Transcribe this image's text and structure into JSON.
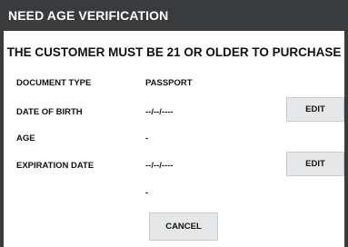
{
  "dialog": {
    "title": "NEED AGE VERIFICATION",
    "message": "THE CUSTOMER MUST BE 21 OR OLDER TO PURCHASE"
  },
  "fields": {
    "document_type": {
      "label": "DOCUMENT TYPE",
      "value": "PASSPORT"
    },
    "date_of_birth": {
      "label": "DATE OF BIRTH",
      "value": "--/--/----",
      "action": "EDIT"
    },
    "age": {
      "label": "AGE",
      "value": "-"
    },
    "expiration_date": {
      "label": "EXPIRATION DATE",
      "value": "--/--/----",
      "action": "EDIT"
    },
    "extra": {
      "value": "-"
    }
  },
  "actions": {
    "cancel": "CANCEL"
  },
  "colors": {
    "titlebar": "#3a3b3d",
    "button_bg": "#e6e7e8",
    "text": "#111111"
  }
}
